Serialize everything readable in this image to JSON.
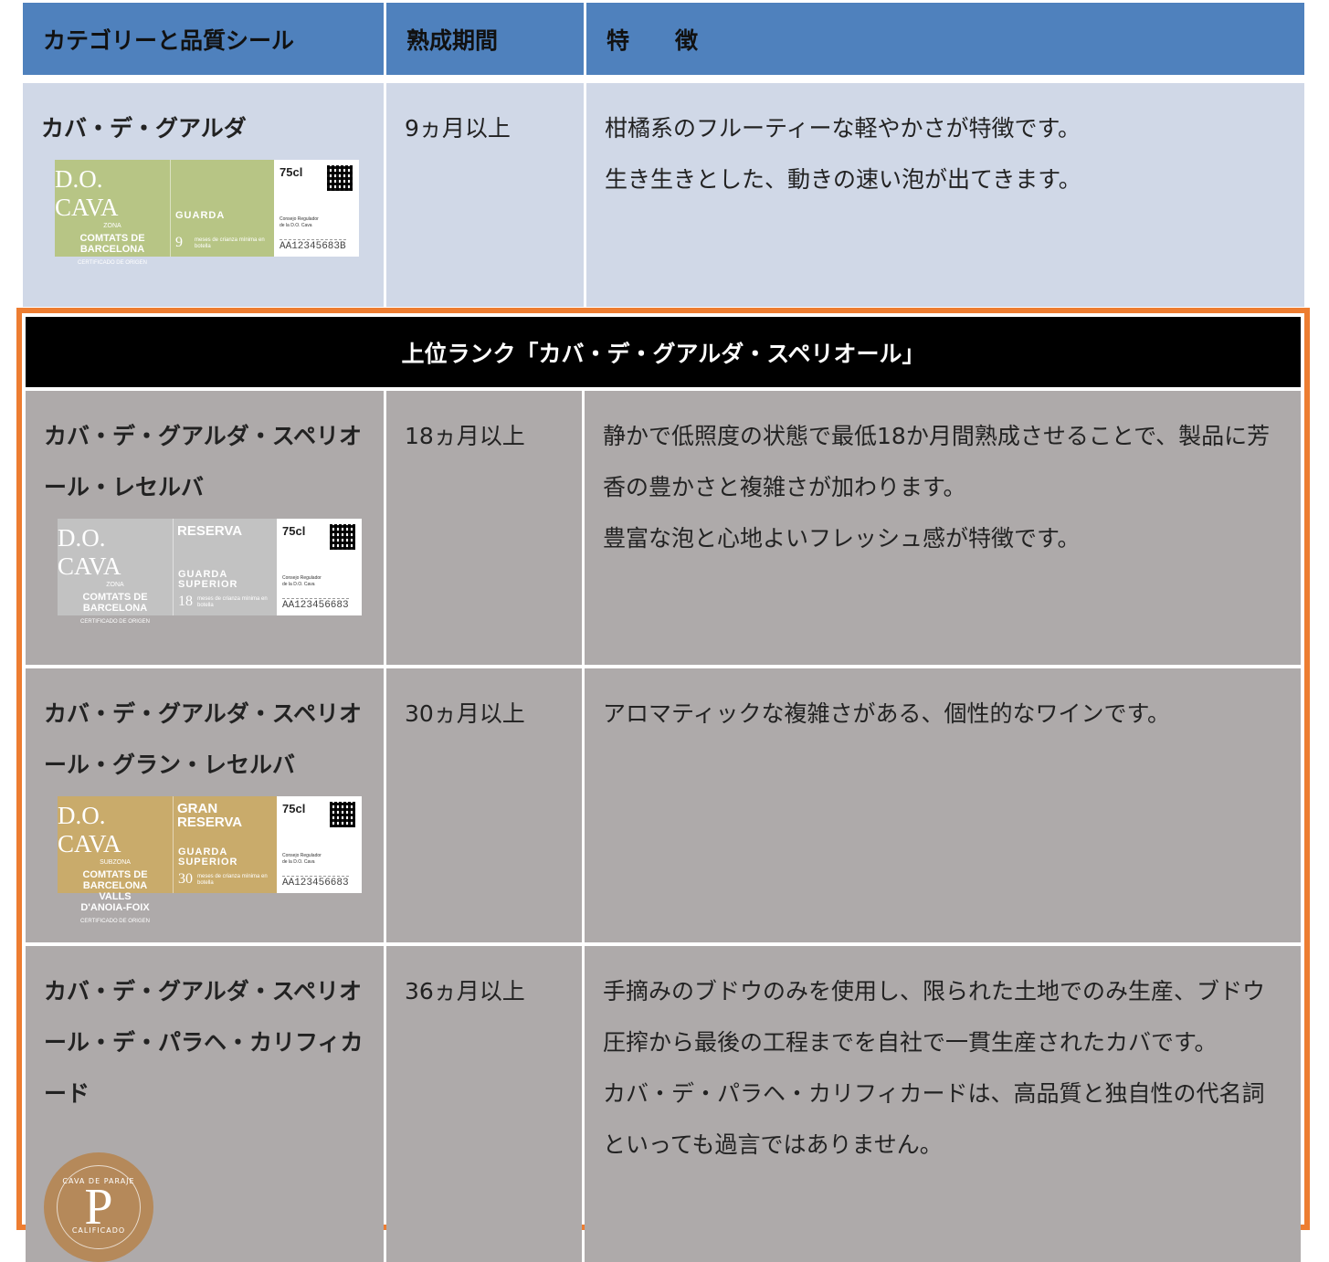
{
  "header": {
    "col1": "カテゴリーと品質シール",
    "col2": "熟成期間",
    "col3": "特　　徴"
  },
  "rows": [
    {
      "category": "カバ・デ・グアルダ",
      "period": "9ヵ月以上",
      "features": [
        "柑橘系のフルーティーな軽やかさが特徴です。",
        "生き生きとした、動きの速い泡が出てきます。"
      ],
      "seal": {
        "color": "#b7c585",
        "brand": "D.O. CAVA",
        "zona": "ZONA",
        "zone": "COMTATS DE\nBARCELONA",
        "cert": "CERTIFICADO DE ORIGEN",
        "class": "",
        "guard": "GUARDA",
        "months": "9",
        "months_text": "meses de crianza mínima en botella",
        "volume": "75cl",
        "consell": "Consejo Regulador\nde la D.O. Cava",
        "code": "AA12345683B"
      }
    }
  ],
  "superior_title": "上位ランク「カバ・デ・グアルダ・スペリオール」",
  "superior_rows": [
    {
      "category": "カバ・デ・グアルダ・スペリオール・レセルバ",
      "period": "18ヵ月以上",
      "features": [
        "静かで低照度の状態で最低18か月間熟成させることで、製品に芳香の豊かさと複雑さが加わります。",
        "豊富な泡と心地よいフレッシュ感が特徴です。"
      ],
      "seal": {
        "color": "#c2c2c2",
        "brand": "D.O. CAVA",
        "zona": "ZONA",
        "zone": "COMTATS DE\nBARCELONA",
        "cert": "CERTIFICADO DE ORIGEN",
        "class": "RESERVA",
        "guard": "GUARDA\nSUPERIOR",
        "months": "18",
        "months_text": "meses de crianza mínima en botella",
        "volume": "75cl",
        "consell": "Consejo Regulador\nde la D.O. Cava",
        "code": "AA123456683"
      }
    },
    {
      "category": "カバ・デ・グアルダ・スペリオール・グラン・レセルバ",
      "period": "30ヵ月以上",
      "features": [
        "アロマティックな複雑さがある、個性的なワインです。"
      ],
      "seal": {
        "color": "#c9ab6b",
        "brand": "D.O. CAVA",
        "zona": "SUBZONA",
        "zone": "COMTATS DE BARCELONA\nVALLS\nD'ANOIA-FOIX",
        "cert": "CERTIFICADO DE ORIGEN",
        "class": "GRAN\nRESERVA",
        "guard": "GUARDA\nSUPERIOR",
        "months": "30",
        "months_text": "meses de crianza mínima en botella",
        "volume": "75cl",
        "consell": "Consejo Regulador\nde la D.O. Cava",
        "code": "AA123456683"
      }
    },
    {
      "category": "カバ・デ・グアルダ・スペリオール・デ・パラヘ・カリフィカード",
      "period": "36ヵ月以上",
      "features": [
        "手摘みのブドウのみを使用し、限られた土地でのみ生産、ブドウ圧搾から最後の工程までを自社で一貫生産されたカバです。",
        "カバ・デ・パラヘ・カリフィカードは、高品質と独自性の代名詞といっても過言ではありません。"
      ],
      "paraje": {
        "color": "#b5895a",
        "letter": "P",
        "top": "CAVA DE PARAJE",
        "bottom": "CALIFICADO"
      }
    }
  ]
}
